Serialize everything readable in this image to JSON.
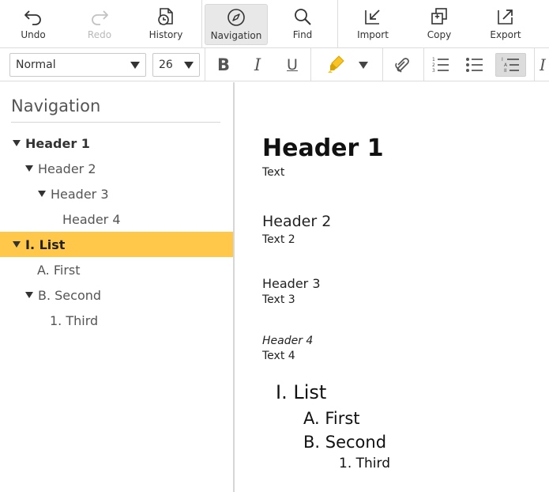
{
  "toolbar": {
    "undo": "Undo",
    "redo": "Redo",
    "history": "History",
    "navigation": "Navigation",
    "find": "Find",
    "import": "Import",
    "copy": "Copy",
    "export": "Export"
  },
  "format": {
    "style_value": "Normal",
    "size_value": "26",
    "bold": "B",
    "italic": "I",
    "underline": "U",
    "highlight_color": "#f7c325",
    "active_list": "outline-list"
  },
  "sidebar": {
    "title": "Navigation",
    "items": [
      {
        "label": "Header 1",
        "level": 0,
        "expanded": true
      },
      {
        "label": "Header 2",
        "level": 1,
        "expanded": true
      },
      {
        "label": "Header 3",
        "level": 2,
        "expanded": true
      },
      {
        "label": "Header 4",
        "level": 3,
        "expanded": false
      },
      {
        "label": "I. List",
        "level": 0,
        "expanded": true,
        "selected": true
      },
      {
        "label": "A. First",
        "level": 1,
        "expanded": false
      },
      {
        "label": "B. Second",
        "level": 1,
        "expanded": true
      },
      {
        "label": "1. Third",
        "level": 2,
        "expanded": false
      }
    ]
  },
  "document": {
    "h1": "Header 1",
    "text1": "Text",
    "h2": "Header 2",
    "text2": "Text 2",
    "h3": "Header 3",
    "text3": "Text 3",
    "h4": "Header 4",
    "text4": "Text 4",
    "list": {
      "item1": "I. List",
      "item2": "A. First",
      "item3": "B. Second",
      "item4": "1. Third"
    }
  },
  "colors": {
    "selected_bg": "#ffc84b",
    "toolbar_border": "#dcdcdc"
  }
}
